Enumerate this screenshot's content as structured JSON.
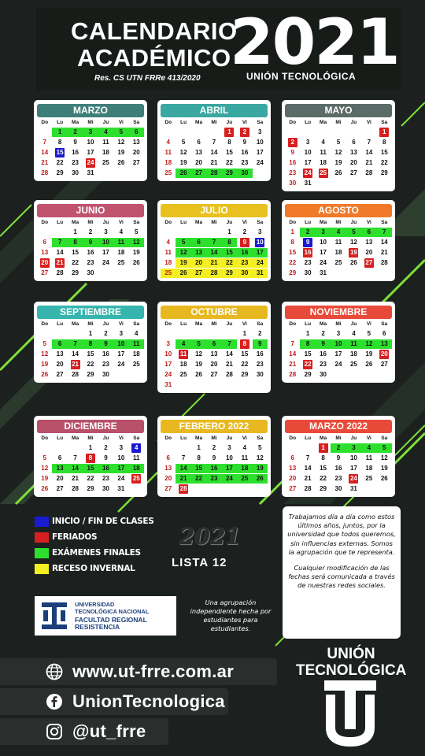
{
  "header": {
    "title_line1": "CALENDARIO",
    "title_line2": "ACADÉMICO",
    "year": "2021",
    "resolution": "Res. CS UTN FRRe 413/2020",
    "brand": "UNIÓN TECNOLÓGICA"
  },
  "weekdays": [
    "Do",
    "Lu",
    "Ma",
    "Mi",
    "Ju",
    "Vi",
    "Sa"
  ],
  "colors": {
    "class": "#1a1ad0",
    "holiday": "#d81f1f",
    "exam": "#2ee02e",
    "recess": "#f3ef22"
  },
  "months": [
    {
      "name": "MARZO",
      "color": "#3f7f7a",
      "first_weekday": 1,
      "days": 31,
      "class": [
        15
      ],
      "holiday": [
        24
      ],
      "exam": [
        1,
        2,
        3,
        4,
        5,
        6
      ],
      "recess": []
    },
    {
      "name": "ABRIL",
      "color": "#3aa7a0",
      "first_weekday": 4,
      "days": 30,
      "class": [],
      "holiday": [
        1,
        2
      ],
      "exam": [
        26,
        27,
        28,
        29,
        30
      ],
      "recess": []
    },
    {
      "name": "MAYO",
      "color": "#5b6b68",
      "first_weekday": 6,
      "days": 31,
      "class": [],
      "holiday": [
        1,
        2,
        24,
        25
      ],
      "exam": [],
      "recess": []
    },
    {
      "name": "JUNIO",
      "color": "#c0546e",
      "first_weekday": 2,
      "days": 30,
      "class": [],
      "holiday": [
        20,
        21
      ],
      "exam": [
        7,
        8,
        9,
        10,
        11,
        12
      ],
      "recess": []
    },
    {
      "name": "JULIO",
      "color": "#e8c020",
      "first_weekday": 4,
      "days": 31,
      "class": [
        10
      ],
      "holiday": [
        9
      ],
      "exam": [
        5,
        6,
        7,
        8,
        12,
        13,
        14,
        15,
        16,
        17
      ],
      "recess": [
        19,
        20,
        21,
        22,
        23,
        24,
        25,
        26,
        27,
        28,
        29,
        30,
        31
      ]
    },
    {
      "name": "AGOSTO",
      "color": "#f07a2a",
      "first_weekday": 0,
      "days": 31,
      "class": [
        9
      ],
      "holiday": [
        16,
        19,
        27
      ],
      "exam": [
        2,
        3,
        4,
        5,
        6,
        7
      ],
      "recess": []
    },
    {
      "name": "SEPTIEMBRE",
      "color": "#35b5ad",
      "first_weekday": 3,
      "days": 30,
      "class": [],
      "holiday": [
        21
      ],
      "exam": [
        6,
        7,
        8,
        9,
        10,
        11
      ],
      "recess": []
    },
    {
      "name": "OCTUBRE",
      "color": "#e8b820",
      "first_weekday": 5,
      "days": 31,
      "class": [],
      "holiday": [
        8,
        11
      ],
      "exam": [
        4,
        5,
        6,
        7,
        9
      ],
      "recess": []
    },
    {
      "name": "NOVIEMBRE",
      "color": "#e84a3a",
      "first_weekday": 1,
      "days": 30,
      "class": [],
      "holiday": [
        20,
        22
      ],
      "exam": [
        8,
        9,
        10,
        11,
        12,
        13
      ],
      "recess": []
    },
    {
      "name": "DICIEMBRE",
      "color": "#b8506a",
      "first_weekday": 3,
      "days": 31,
      "class": [
        4
      ],
      "holiday": [
        8,
        25
      ],
      "exam": [
        13,
        14,
        15,
        16,
        17,
        18
      ],
      "recess": []
    },
    {
      "name": "FEBRERO 2022",
      "color": "#e8b820",
      "first_weekday": 2,
      "days": 28,
      "class": [],
      "holiday": [
        28
      ],
      "exam": [
        14,
        15,
        16,
        17,
        18,
        19,
        21,
        22,
        23,
        24,
        25,
        26
      ],
      "recess": []
    },
    {
      "name": "MARZO 2022",
      "color": "#e84a3a",
      "first_weekday": 2,
      "days": 31,
      "class": [],
      "holiday": [
        1,
        24
      ],
      "exam": [
        2,
        3,
        4,
        5
      ],
      "recess": []
    }
  ],
  "legend": [
    {
      "label": "INICIO / FIN DE CLASES",
      "color": "#1a1ad0"
    },
    {
      "label": "FERIADOS",
      "color": "#d81f1f"
    },
    {
      "label": "EXÁMENES FINALES",
      "color": "#2ee02e"
    },
    {
      "label": "RECESO INVERNAL",
      "color": "#f3ef22"
    }
  ],
  "lista": {
    "year": "2021",
    "label": "LISTA 12"
  },
  "info": {
    "p1": "Trabajamos día a día como estos últimos años, juntos, por la universidad que todos queremos, sin influencias externas. Somos la agrupación que te representa.",
    "p2": "Cualquier modificación de las fechas será comunicada a través de nuestras redes sociales."
  },
  "university": {
    "line1": "UNIVERSIDAD",
    "line2": "TECNOLÓGICA NACIONAL",
    "line3": "FACULTAD REGIONAL",
    "line4": "RESISTENCIA"
  },
  "tagline": "Una agrupación independiente hecha por estudiantes para estudiantes.",
  "social": {
    "web": "www.ut-frre.com.ar",
    "facebook": "UnionTecnologica",
    "instagram": "@ut_frre"
  },
  "brand": {
    "line1": "UNIÓN",
    "line2": "TECNOLÓGICA"
  }
}
